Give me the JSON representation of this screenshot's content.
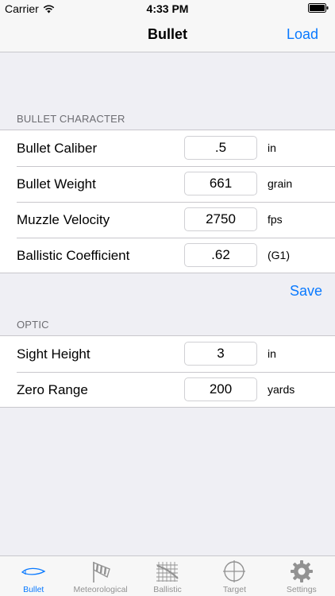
{
  "status_bar": {
    "carrier": "Carrier",
    "time": "4:33 PM"
  },
  "nav": {
    "title": "Bullet",
    "load_label": "Load"
  },
  "bullet_section": {
    "header": "BULLET CHARACTER",
    "rows": [
      {
        "label": "Bullet Caliber",
        "value": ".5",
        "unit": "in"
      },
      {
        "label": "Bullet Weight",
        "value": "661",
        "unit": "grain"
      },
      {
        "label": "Muzzle Velocity",
        "value": "2750",
        "unit": "fps"
      },
      {
        "label": "Ballistic Coefficient",
        "value": ".62",
        "unit": "(G1)"
      }
    ],
    "save_label": "Save"
  },
  "optic_section": {
    "header": "OPTIC",
    "rows": [
      {
        "label": "Sight Height",
        "value": "3",
        "unit": "in"
      },
      {
        "label": "Zero Range",
        "value": "200",
        "unit": "yards"
      }
    ]
  },
  "tabs": [
    {
      "label": "Bullet",
      "icon": "bullet-icon",
      "active": true
    },
    {
      "label": "Meteorological",
      "icon": "windsock-icon",
      "active": false
    },
    {
      "label": "Ballistic",
      "icon": "ballistic-grid-icon",
      "active": false
    },
    {
      "label": "Target",
      "icon": "crosshair-icon",
      "active": false
    },
    {
      "label": "Settings",
      "icon": "gear-icon",
      "active": false
    }
  ],
  "colors": {
    "accent": "#0a7aff",
    "background": "#efeff4",
    "inactive_tab": "#929292"
  }
}
